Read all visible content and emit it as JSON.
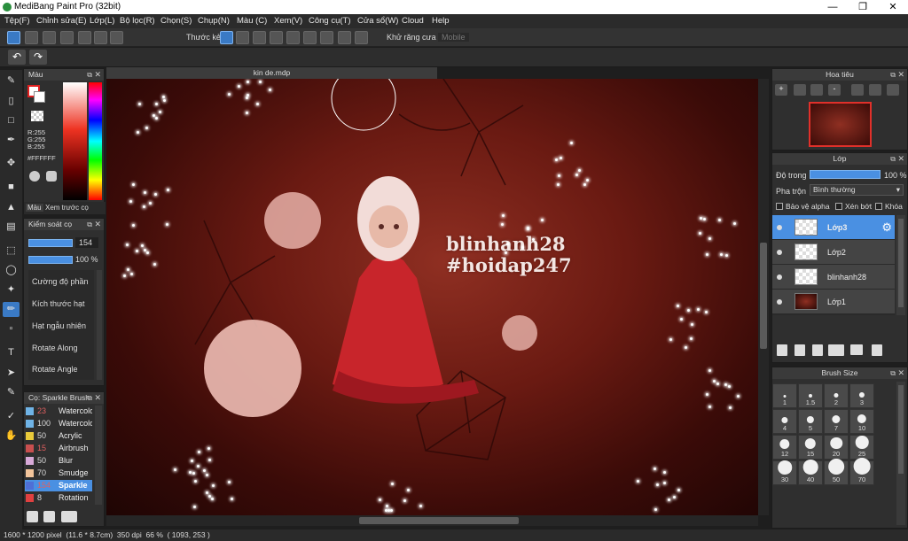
{
  "app": {
    "title": "MediBang Paint Pro (32bit)"
  },
  "menu": [
    "Tệp(F)",
    "Chỉnh sửa(E)",
    "Lớp(L)",
    "Bộ lọc(R)",
    "Chọn(S)",
    "Chụp(N)",
    "Màu (C)",
    "Xem(V)",
    "Công cụ(T)",
    "Cửa sổ(W)",
    "Cloud",
    "Help"
  ],
  "toolbar": {
    "ruler_label": "Thước kẻ",
    "antialias_label": "Khử răng cưa",
    "disabled_field": "Mobile"
  },
  "canvas": {
    "tab_title": "kin de.mdp",
    "text_line1": "blinhanh28",
    "text_line2": "#hoidap247"
  },
  "color_panel": {
    "title": "Màu",
    "r": "R:255",
    "g": "G:255",
    "b": "B:255",
    "hex": "#FFFFFF",
    "tab1": "Màu",
    "tab2": "Xem trước cọ"
  },
  "brush_control": {
    "title": "Kiểm soát cọ",
    "size_value": "154",
    "opacity_value": "100 %",
    "options": [
      "Cường độ phần",
      "Kích thước hạt",
      "Hạt ngẫu nhiên",
      "Rotate Along",
      "Rotate Angle"
    ]
  },
  "brush_list": {
    "title": "Cọ: Sparkle Brush",
    "items": [
      {
        "size": "23",
        "name": "Watercolor",
        "color": "#6fb3e6"
      },
      {
        "size": "100",
        "name": "Watercolor",
        "color": "#6fb3e6"
      },
      {
        "size": "50",
        "name": "Acrylic",
        "color": "#e8c93a"
      },
      {
        "size": "15",
        "name": "Airbrush",
        "color": "#c94f4f"
      },
      {
        "size": "50",
        "name": "Blur",
        "color": "#d8a9d8"
      },
      {
        "size": "70",
        "name": "Smudge",
        "color": "#f2c49b"
      },
      {
        "size": "154",
        "name": "Sparkle",
        "color": "#4f6fd6"
      },
      {
        "size": "8",
        "name": "Rotation",
        "color": "#e04040"
      }
    ]
  },
  "navigator": {
    "title": "Hoa tiêu"
  },
  "layers": {
    "title": "Lớp",
    "opacity_label": "Độ trong",
    "opacity_value": "100 %",
    "blend_label": "Pha trộn",
    "blend_value": "Bình thường",
    "protect_alpha": "Bảo vệ alpha",
    "clipping": "Xén bớt",
    "lock": "Khóa",
    "items": [
      {
        "name": "Lớp3"
      },
      {
        "name": "Lớp2"
      },
      {
        "name": "blinhanh28"
      },
      {
        "name": "Lớp1"
      }
    ]
  },
  "brush_size": {
    "title": "Brush Size",
    "sizes": [
      "1",
      "1.5",
      "2",
      "3",
      "4",
      "5",
      "7",
      "10",
      "12",
      "15",
      "20",
      "25",
      "30",
      "40",
      "50",
      "70"
    ]
  },
  "status": {
    "text": "1600 * 1200 pixel  (11.6 * 8.7cm)  350 dpi  66 %  ( 1093, 253 )"
  }
}
